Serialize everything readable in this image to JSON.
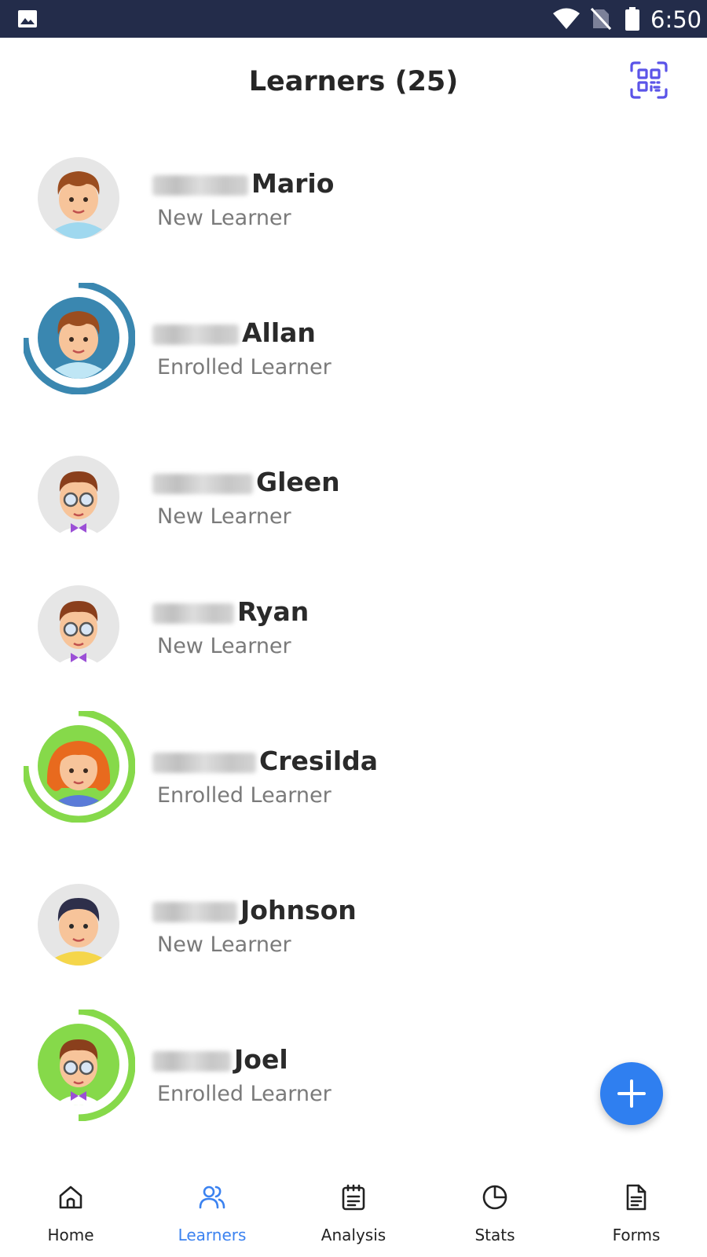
{
  "status_bar": {
    "time": "6:50",
    "icons": [
      "gallery-icon",
      "wifi-icon",
      "no-sim-icon",
      "battery-icon"
    ]
  },
  "header": {
    "title": "Learners (25)",
    "qr_icon": "qr-scan-icon"
  },
  "learners": [
    {
      "name": "Mario",
      "role": "New Learner",
      "ring": "none"
    },
    {
      "name": "Allan",
      "role": "Enrolled Learner",
      "ring": "blue"
    },
    {
      "name": "Gleen",
      "role": "New Learner",
      "ring": "none"
    },
    {
      "name": "Ryan",
      "role": "New Learner",
      "ring": "none"
    },
    {
      "name": "Cresilda",
      "role": "Enrolled Learner",
      "ring": "green"
    },
    {
      "name": "Johnson",
      "role": "New Learner",
      "ring": "none"
    },
    {
      "name": "Joel",
      "role": "Enrolled Learner",
      "ring": "green"
    }
  ],
  "fab": {
    "icon": "plus-icon"
  },
  "bottom_nav": {
    "items": [
      {
        "label": "Home",
        "icon": "home-icon",
        "active": false
      },
      {
        "label": "Learners",
        "icon": "users-icon",
        "active": true
      },
      {
        "label": "Analysis",
        "icon": "clipboard-icon",
        "active": false
      },
      {
        "label": "Stats",
        "icon": "pie-chart-icon",
        "active": false
      },
      {
        "label": "Forms",
        "icon": "document-icon",
        "active": false
      }
    ]
  },
  "colors": {
    "status_bar": "#232c4a",
    "accent": "#3b82f0",
    "ring_blue": "#3a87b0",
    "ring_green": "#86d94a",
    "avatar_bg": "#e6e6e6",
    "fab": "#2f7ff0"
  }
}
